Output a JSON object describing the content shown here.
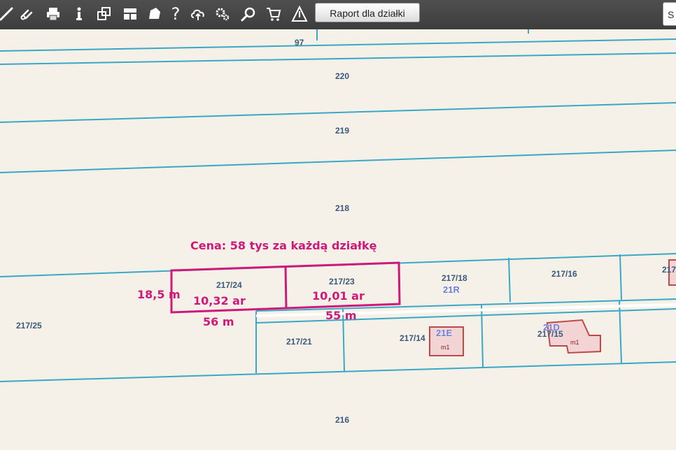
{
  "toolbar": {
    "report_button_label": "Raport dla działki",
    "right_box_text": "S",
    "icons": [
      "measure-icon",
      "link-icon",
      "print-icon",
      "info-icon",
      "layers-icon",
      "layout-icon",
      "shape-icon",
      "help-icon",
      "upload-icon",
      "settings-icon",
      "search-icon",
      "cart-icon",
      "warning-icon"
    ],
    "help_glyph": "?"
  },
  "map": {
    "parcels": {
      "p97": "97",
      "p220": "220",
      "p219": "219",
      "p218": "218",
      "p216": "216",
      "p217_25": "217/25",
      "p217_24": "217/24",
      "p217_23": "217/23",
      "p217_18": "217/18",
      "p217_16": "217/16",
      "p217_21": "217/21",
      "p217_14": "217/14",
      "p217_15": "217/15",
      "p217_edge": "217"
    },
    "buildings": {
      "b21R": "21R",
      "b21E": "21E",
      "b21D": "21D",
      "m1a": "m1",
      "m1b": "m1"
    },
    "annotations": {
      "price": "Cena: 58 tys za każdą działkę",
      "width": "18,5 m",
      "area_24": "10,32 ar",
      "area_23": "10,01 ar",
      "length_24": "56 m",
      "length_23": "55 m"
    },
    "colors": {
      "background": "#f6f1e8",
      "parcel_line": "#39a8c6",
      "highlight": "#d0187a",
      "label": "#3a5a7c",
      "building": "#c04848"
    }
  }
}
